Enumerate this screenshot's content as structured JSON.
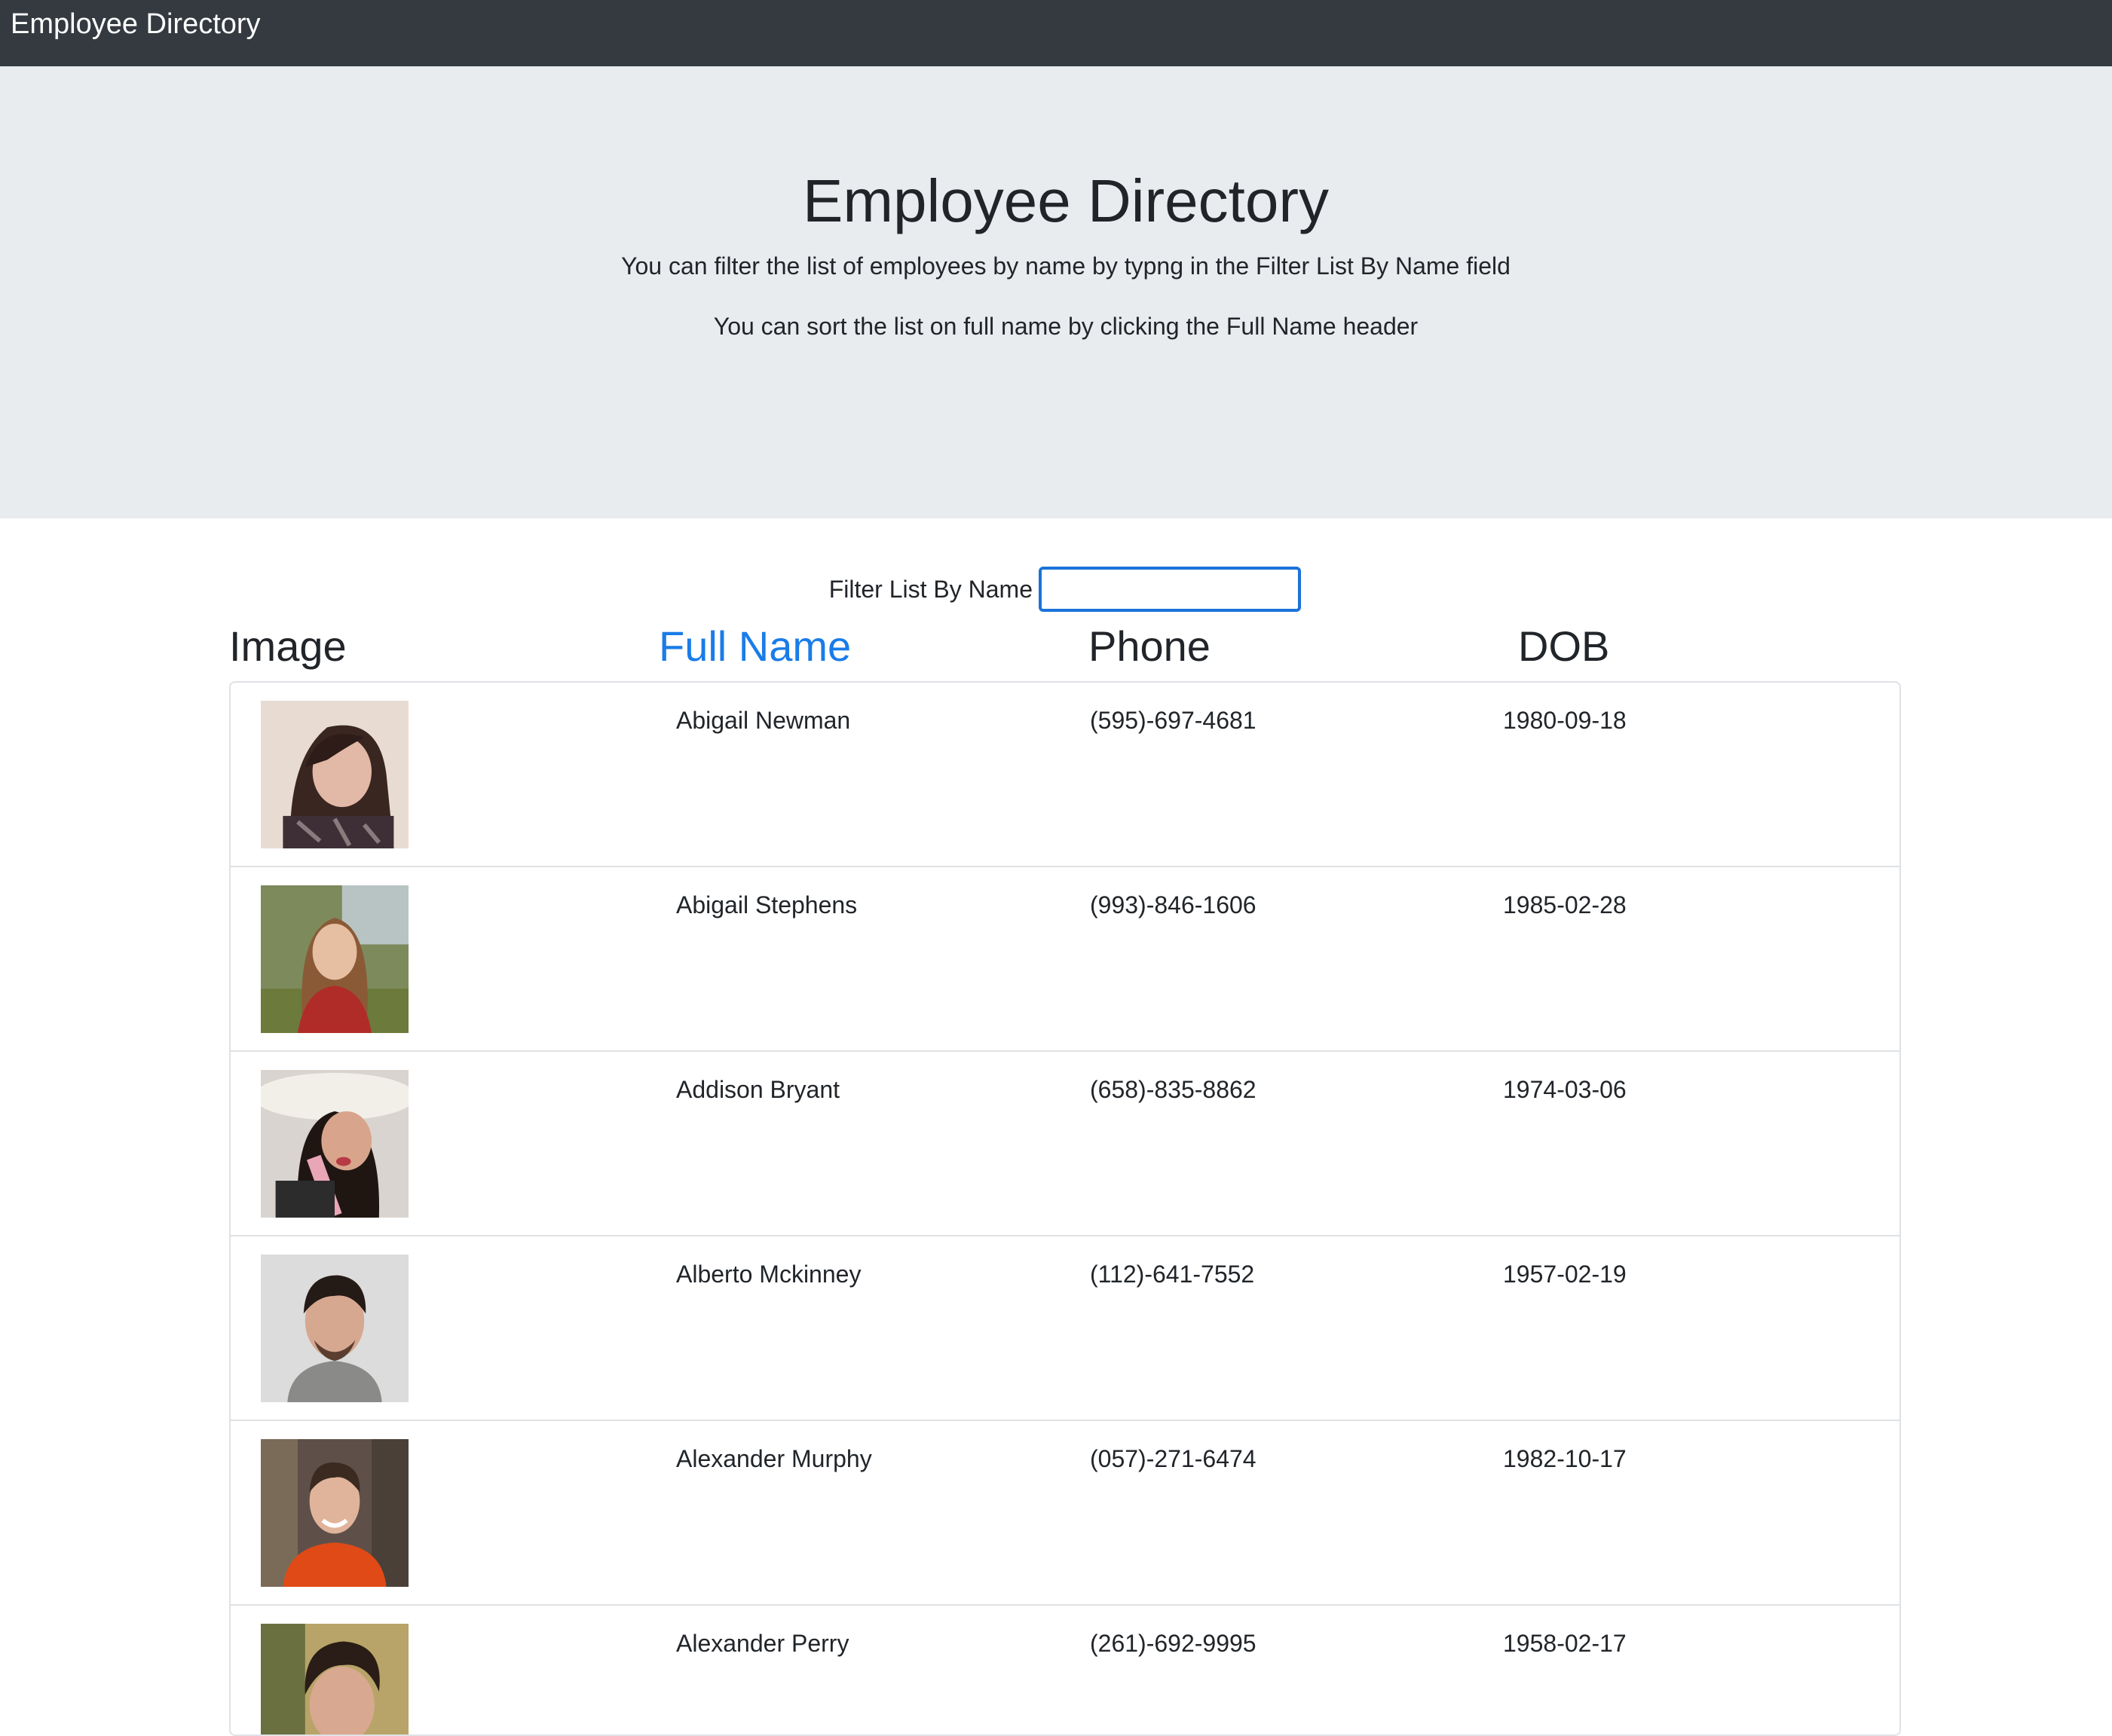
{
  "navbar": {
    "brand": "Employee Directory"
  },
  "jumbotron": {
    "title": "Employee Directory",
    "line1": "You can filter the list of employees by name by typng in the Filter List By Name field",
    "line2": "You can sort the list on full name by clicking the Full Name header"
  },
  "filter": {
    "label": "Filter List By Name",
    "value": ""
  },
  "table": {
    "headers": {
      "image": "Image",
      "full_name": "Full Name",
      "phone": "Phone",
      "dob": "DOB"
    },
    "rows": [
      {
        "name": "Abigail Newman",
        "phone": "(595)-697-4681",
        "dob": "1980-09-18",
        "avatar": "woman-dark-hair-photo"
      },
      {
        "name": "Abigail Stephens",
        "phone": "(993)-846-1606",
        "dob": "1985-02-28",
        "avatar": "woman-red-top-photo"
      },
      {
        "name": "Addison Bryant",
        "phone": "(658)-835-8862",
        "dob": "1974-03-06",
        "avatar": "woman-white-hat-photo"
      },
      {
        "name": "Alberto Mckinney",
        "phone": "(112)-641-7552",
        "dob": "1957-02-19",
        "avatar": "man-grey-shirt-photo"
      },
      {
        "name": "Alexander Murphy",
        "phone": "(057)-271-6474",
        "dob": "1982-10-17",
        "avatar": "man-orange-sweater-photo"
      },
      {
        "name": "Alexander Perry",
        "phone": "(261)-692-9995",
        "dob": "1958-02-17",
        "avatar": "man-dark-hair-photo"
      }
    ]
  },
  "colors": {
    "navbar_bg": "#343a40",
    "jumbotron_bg": "#e9ecef",
    "sortable_header": "#1a7ce8",
    "input_focus_border": "#1a73d9"
  }
}
